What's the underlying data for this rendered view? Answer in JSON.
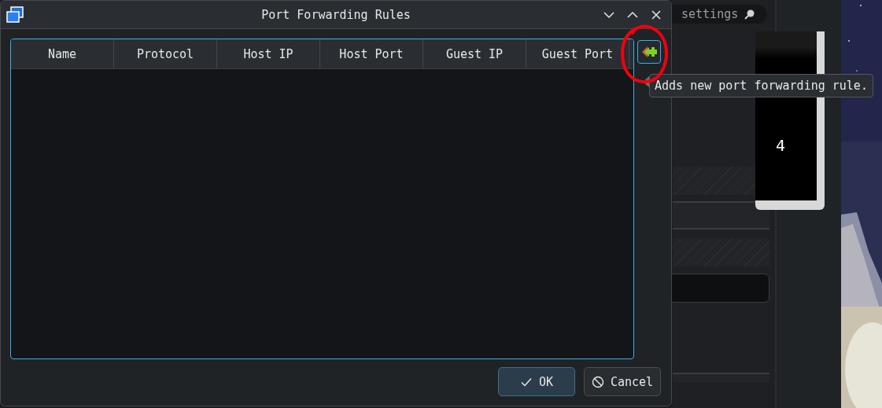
{
  "window": {
    "title": "Port Forwarding Rules"
  },
  "table": {
    "columns": [
      "Name",
      "Protocol",
      "Host IP",
      "Host Port",
      "Guest IP",
      "Guest Port"
    ]
  },
  "side_buttons": [
    {
      "kind": "add",
      "disabled": false
    },
    {
      "kind": "remove",
      "disabled": true
    }
  ],
  "tooltip": {
    "text": "Adds new port forwarding rule."
  },
  "buttons": [
    {
      "kind": "ok",
      "label": "OK",
      "default": true
    },
    {
      "kind": "cancel",
      "label": "Cancel",
      "default": false
    }
  ],
  "background": {
    "search": {
      "value": "settings"
    },
    "preview_text": "4"
  }
}
